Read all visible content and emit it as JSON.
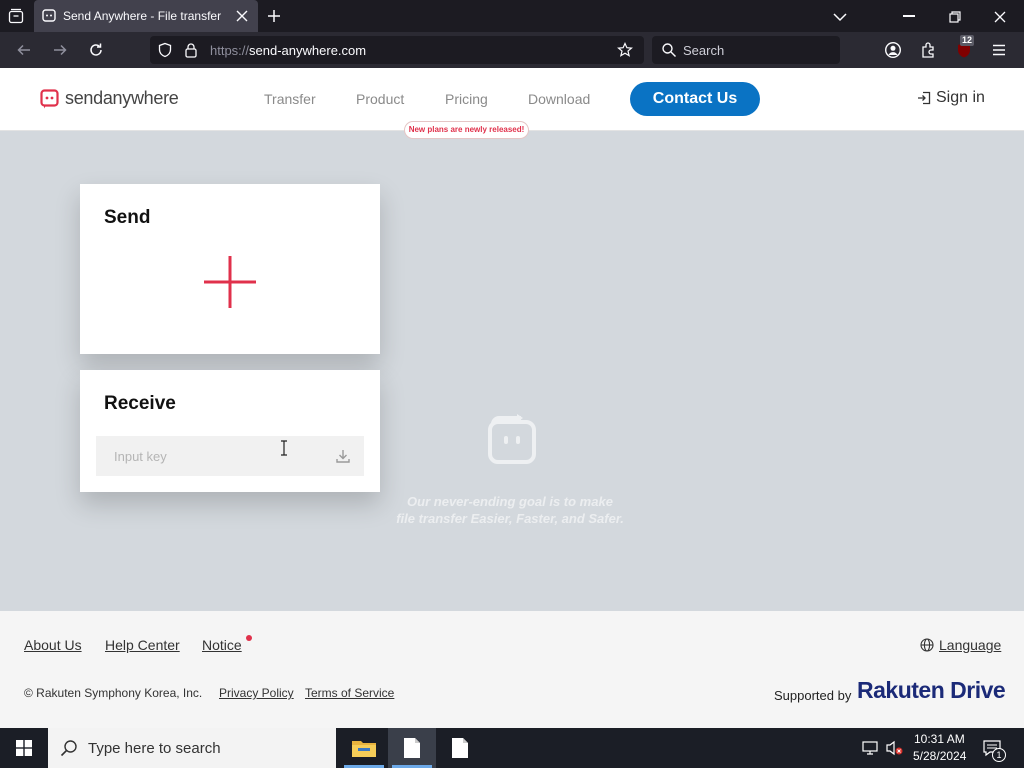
{
  "browser": {
    "tab_title": "Send Anywhere - File transfer",
    "url_prefix": "https://",
    "url_domain": "send-anywhere.com",
    "search_placeholder": "Search",
    "extension_badge": "12"
  },
  "site": {
    "logo_text": "sendanywhere",
    "nav": [
      "Transfer",
      "Product",
      "Pricing",
      "Download"
    ],
    "contact_label": "Contact Us",
    "pricing_badge": "New plans are newly released!",
    "sign_in_label": "Sign in"
  },
  "send_card": {
    "title": "Send"
  },
  "receive_card": {
    "title": "Receive",
    "input_placeholder": "Input key"
  },
  "hero": {
    "tagline_line1": "Our never-ending goal is to make",
    "tagline_line2": "file transfer Easier, Faster, and Safer."
  },
  "footer": {
    "links": [
      "About Us",
      "Help Center",
      "Notice"
    ],
    "language_label": "Language",
    "copyright": "© Rakuten Symphony Korea, Inc.",
    "privacy": "Privacy Policy",
    "terms": "Terms of Service",
    "supported_by": "Supported by",
    "sponsor_brand": "Rakuten Drive"
  },
  "taskbar": {
    "search_placeholder": "Type here to search",
    "time": "10:31 AM",
    "date": "5/28/2024",
    "notification_count": "1"
  },
  "colors": {
    "brand_red": "#e0314b",
    "contact_blue": "#0a73c4",
    "hero_bg": "#d3d8dd",
    "rakuten_navy": "#1b2a78"
  }
}
